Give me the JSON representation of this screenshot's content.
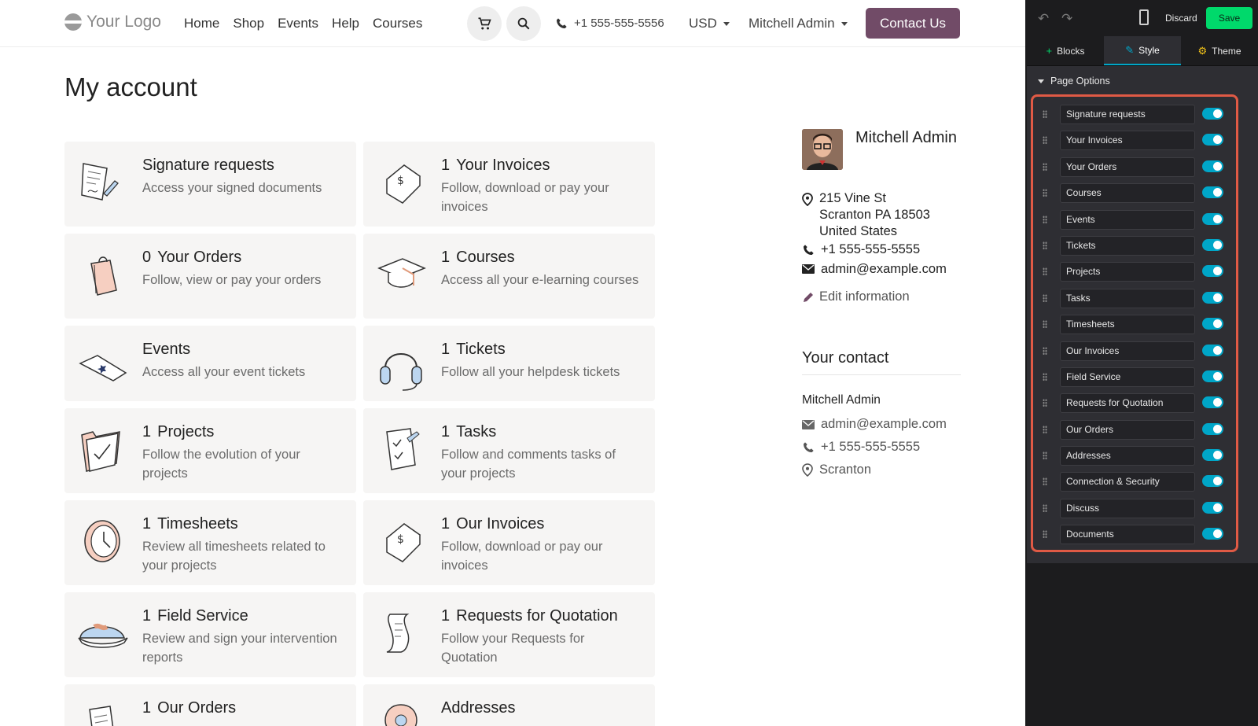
{
  "header": {
    "logo": "Your Logo",
    "menu": [
      "Home",
      "Shop",
      "Events",
      "Help",
      "Courses"
    ],
    "phone": "+1 555-555-5556",
    "currency": "USD",
    "user": "Mitchell Admin",
    "contact_button": "Contact Us"
  },
  "page": {
    "title": "My account",
    "cards": [
      {
        "count": "",
        "title": "Signature requests",
        "desc": "Access your signed documents",
        "icon": "signature-icon"
      },
      {
        "count": "1",
        "title": "Your Invoices",
        "desc": "Follow, download or pay your invoices",
        "icon": "invoice-envelope-icon"
      },
      {
        "count": "0",
        "title": "Your Orders",
        "desc": "Follow, view or pay your orders",
        "icon": "shopping-bag-icon"
      },
      {
        "count": "1",
        "title": "Courses",
        "desc": "Access all your e-learning courses",
        "icon": "graduation-cap-icon"
      },
      {
        "count": "",
        "title": "Events",
        "desc": "Access all your event tickets",
        "icon": "event-ticket-icon"
      },
      {
        "count": "1",
        "title": "Tickets",
        "desc": "Follow all your helpdesk tickets",
        "icon": "headset-icon"
      },
      {
        "count": "1",
        "title": "Projects",
        "desc": "Follow the evolution of your projects",
        "icon": "folder-check-icon"
      },
      {
        "count": "1",
        "title": "Tasks",
        "desc": "Follow and comments tasks of your projects",
        "icon": "clipboard-check-icon"
      },
      {
        "count": "1",
        "title": "Timesheets",
        "desc": "Review all timesheets related to your projects",
        "icon": "clock-icon"
      },
      {
        "count": "1",
        "title": "Our Invoices",
        "desc": "Follow, download or pay our invoices",
        "icon": "invoice-envelope-icon"
      },
      {
        "count": "1",
        "title": "Field Service",
        "desc": "Review and sign your intervention reports",
        "icon": "hard-hat-icon"
      },
      {
        "count": "1",
        "title": "Requests for Quotation",
        "desc": "Follow your Requests for Quotation",
        "icon": "scroll-icon"
      },
      {
        "count": "1",
        "title": "Our Orders",
        "desc": "",
        "icon": "document-icon"
      },
      {
        "count": "",
        "title": "Addresses",
        "desc": "",
        "icon": "map-pin-icon"
      }
    ]
  },
  "profile": {
    "name": "Mitchell Admin",
    "address_line1": "215 Vine St",
    "address_line2": "Scranton PA 18503",
    "address_line3": "United States",
    "phone": "+1 555-555-5555",
    "email": "admin@example.com",
    "edit": "Edit information"
  },
  "contact": {
    "heading": "Your contact",
    "name": "Mitchell Admin",
    "email": "admin@example.com",
    "phone": "+1 555-555-5555",
    "city": "Scranton"
  },
  "editor": {
    "discard": "Discard",
    "save": "Save",
    "tabs": [
      "Blocks",
      "Style",
      "Theme"
    ],
    "active_tab": "Style",
    "section": "Page Options",
    "options": [
      {
        "label": "Signature requests",
        "enabled": true
      },
      {
        "label": "Your Invoices",
        "enabled": true
      },
      {
        "label": "Your Orders",
        "enabled": true
      },
      {
        "label": "Courses",
        "enabled": true
      },
      {
        "label": "Events",
        "enabled": true
      },
      {
        "label": "Tickets",
        "enabled": true
      },
      {
        "label": "Projects",
        "enabled": true
      },
      {
        "label": "Tasks",
        "enabled": true
      },
      {
        "label": "Timesheets",
        "enabled": true
      },
      {
        "label": "Our Invoices",
        "enabled": true
      },
      {
        "label": "Field Service",
        "enabled": true
      },
      {
        "label": "Requests for Quotation",
        "enabled": true
      },
      {
        "label": "Our Orders",
        "enabled": true
      },
      {
        "label": "Addresses",
        "enabled": true
      },
      {
        "label": "Connection & Security",
        "enabled": true
      },
      {
        "label": "Discuss",
        "enabled": true
      },
      {
        "label": "Documents",
        "enabled": true
      }
    ]
  },
  "colors": {
    "brand": "#714b67",
    "toggle_on": "#00a6c8",
    "save": "#00d96b",
    "highlight": "#e05a45"
  }
}
